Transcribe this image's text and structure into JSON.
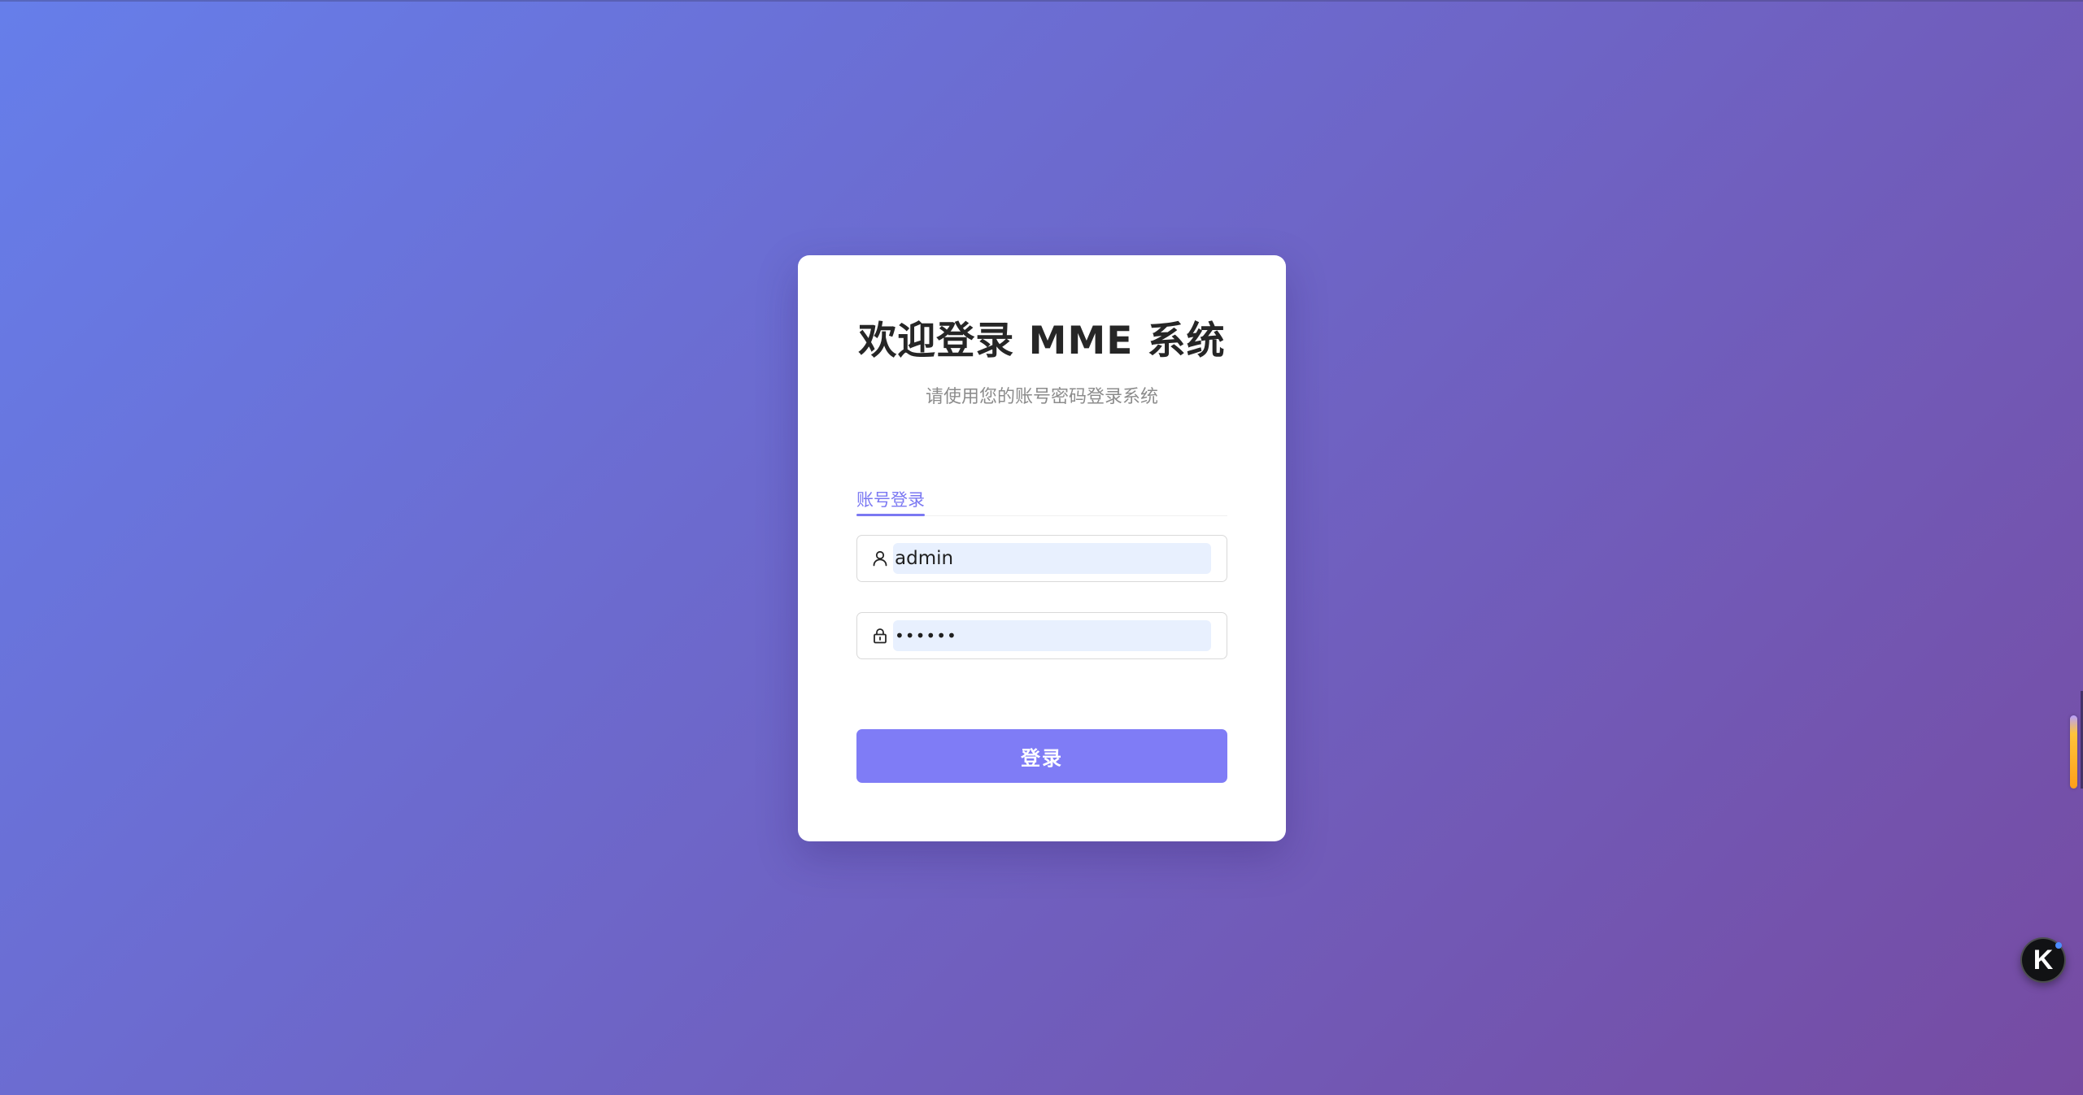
{
  "login": {
    "title": "欢迎登录 MME 系统",
    "subtitle": "请使用您的账号密码登录系统",
    "tabs": [
      {
        "label": "账号登录",
        "active": true
      }
    ],
    "username": {
      "value": "admin",
      "icon": "user-icon"
    },
    "password": {
      "value": "••••••",
      "icon": "lock-icon"
    },
    "submit_label": "登录"
  },
  "floating_widget": {
    "label": "K"
  },
  "colors": {
    "background_start": "#667eea",
    "background_end": "#764ba2",
    "accent": "#7b78f2",
    "button": "#7f7cf6",
    "autofill": "#e8f0fe"
  }
}
